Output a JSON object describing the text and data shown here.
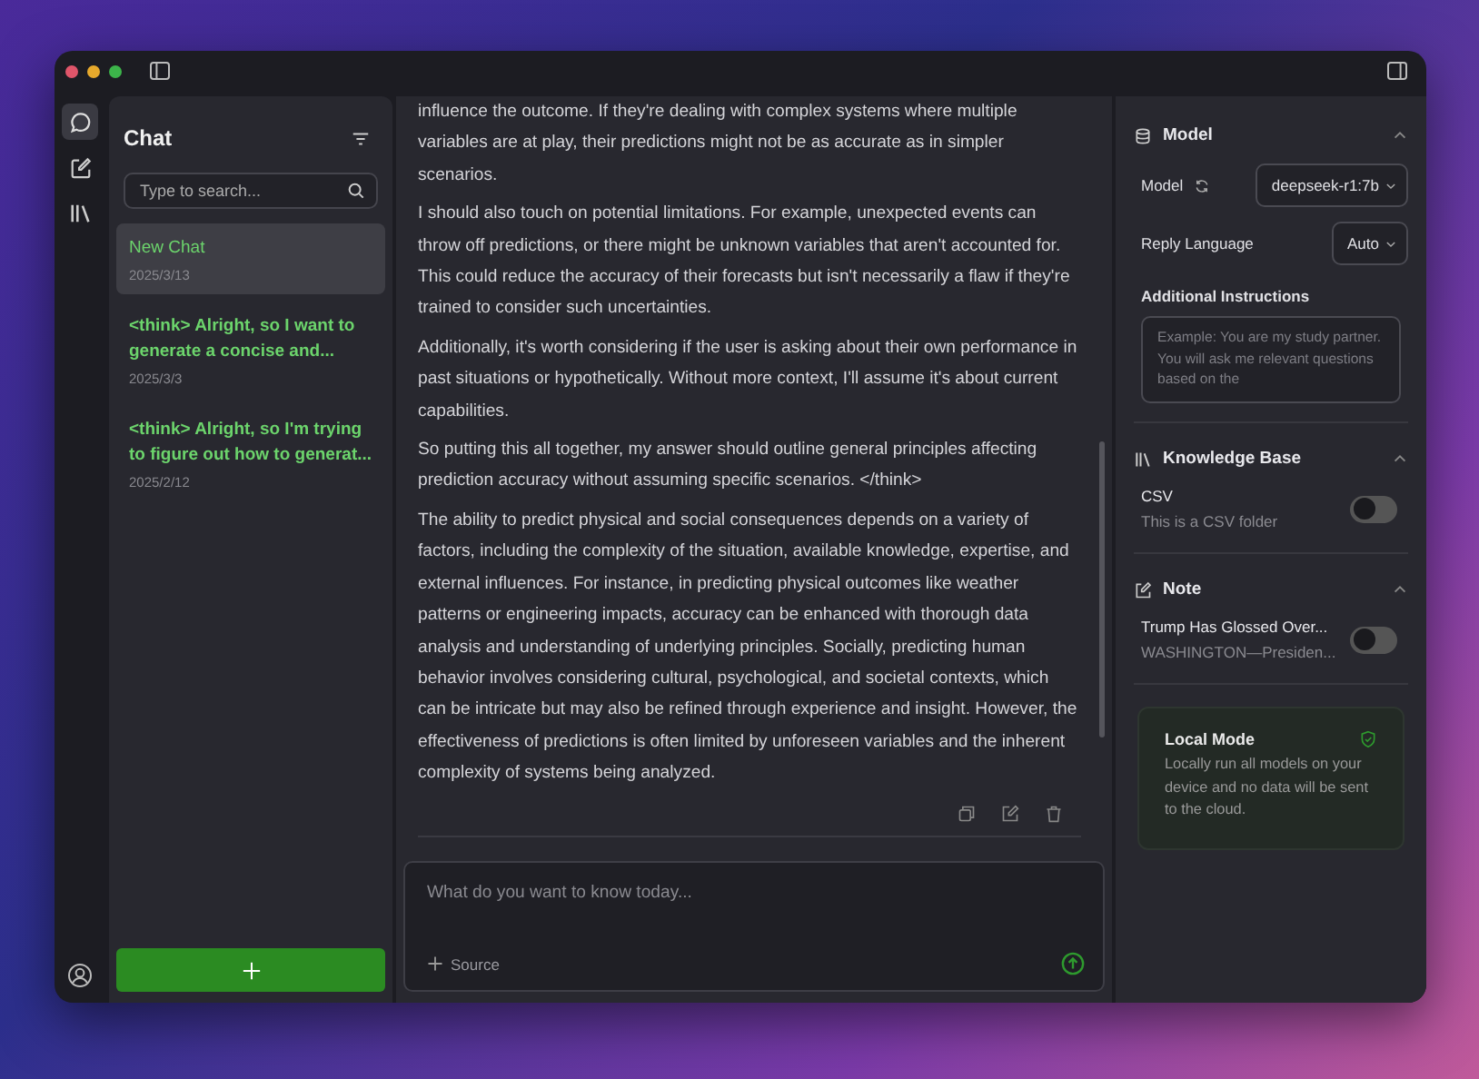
{
  "rail": {
    "items": [
      {
        "kind": "chat",
        "selected": true
      },
      {
        "kind": "note",
        "selected": false
      },
      {
        "kind": "library",
        "selected": false
      }
    ]
  },
  "chat_list": {
    "title": "Chat",
    "search": {
      "placeholder": "Type to search..."
    },
    "items": [
      {
        "title": "New Chat",
        "date": "2025/3/13",
        "selected": true
      },
      {
        "title": "<think> Alright, so I want to generate a concise and...",
        "date": "2025/3/3",
        "selected": false
      },
      {
        "title": "<think> Alright, so I'm trying to figure out how to generat...",
        "date": "2025/2/12",
        "selected": false
      }
    ]
  },
  "conversation": {
    "paragraphs": [
      "influence the outcome. If they're dealing with complex systems where multiple variables are at play, their predictions might not be as accurate as in simpler scenarios.",
      "I should also touch on potential limitations. For example, unexpected events can throw off predictions, or there might be unknown variables that aren't accounted for. This could reduce the accuracy of their forecasts but isn't necessarily a flaw if they're trained to consider such uncertainties.",
      "Additionally, it's worth considering if the user is asking about their own performance in past situations or hypothetically. Without more context, I'll assume it's about current capabilities.",
      "So putting this all together, my answer should outline general principles affecting prediction accuracy without assuming specific scenarios. </think>",
      "The ability to predict physical and social consequences depends on a variety of factors, including the complexity of the situation, available knowledge, expertise, and external influences. For instance, in predicting physical outcomes like weather patterns or engineering impacts, accuracy can be enhanced with thorough data analysis and understanding of underlying principles. Socially, predicting human behavior involves considering cultural, psychological, and societal contexts, which can be intricate but may also be refined through experience and insight. However, the effectiveness of predictions is often limited by unforeseen variables and the inherent complexity of systems being analyzed."
    ]
  },
  "composer": {
    "placeholder": "What do you want to know today...",
    "source_label": "Source"
  },
  "settings": {
    "model": {
      "title": "Model",
      "expanded": true,
      "model_label": "Model",
      "model_value": "deepseek-r1:7b",
      "language_label": "Reply Language",
      "language_value": "Auto",
      "instructions_label": "Additional Instructions",
      "instructions_placeholder": "Example: You are my study partner. You will ask me relevant questions based on the"
    },
    "knowledge_base": {
      "title": "Knowledge Base",
      "expanded": true,
      "items": [
        {
          "name": "CSV",
          "description": "This is a CSV folder",
          "on": false
        }
      ]
    },
    "note": {
      "title": "Note",
      "expanded": true,
      "items": [
        {
          "name": "Trump Has Glossed Over...",
          "description": "WASHINGTON—Presiden...",
          "on": false
        }
      ]
    },
    "local_mode": {
      "title": "Local Mode",
      "description": "Locally run all models on your device and no data will be sent to the cloud."
    }
  }
}
